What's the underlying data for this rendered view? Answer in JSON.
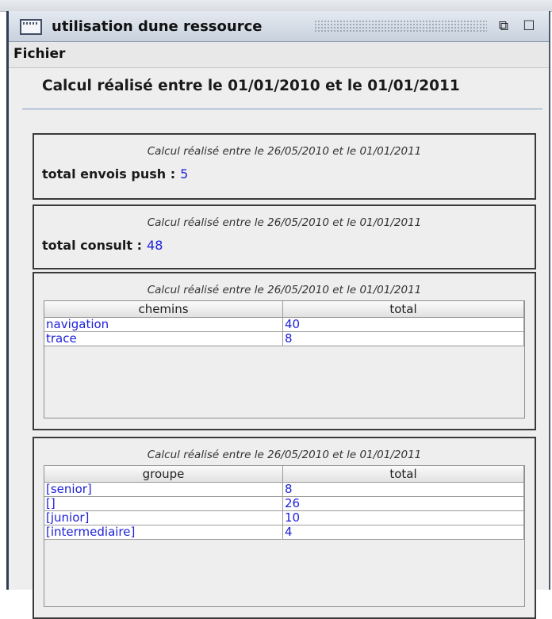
{
  "window": {
    "title": "utilisation dune ressource",
    "restore_icon": "restore-icon",
    "maximize_icon": "maximize-icon"
  },
  "menu": {
    "fichier": "Fichier"
  },
  "main": {
    "heading": "Calcul réalisé entre le 01/01/2010 et le 01/01/2011"
  },
  "panels": {
    "push": {
      "subtitle": "Calcul réalisé entre le 26/05/2010 et le 01/01/2011",
      "label": "total envois push :",
      "value": "5"
    },
    "consult": {
      "subtitle": "Calcul réalisé entre le 26/05/2010 et le 01/01/2011",
      "label": "total consult :",
      "value": "48"
    },
    "chemins": {
      "subtitle": "Calcul réalisé entre le 26/05/2010 et le 01/01/2011",
      "headers": [
        "chemins",
        "total"
      ],
      "rows": [
        [
          "navigation",
          "40"
        ],
        [
          "trace",
          "8"
        ]
      ]
    },
    "groupe": {
      "subtitle": "Calcul réalisé entre le 26/05/2010 et le 01/01/2011",
      "headers": [
        "groupe",
        "total"
      ],
      "rows": [
        [
          "[senior]",
          "8"
        ],
        [
          "[]",
          "26"
        ],
        [
          "[junior]",
          "10"
        ],
        [
          "[intermediaire]",
          "4"
        ]
      ]
    }
  },
  "colors": {
    "value_text": "#1f22d8",
    "border": "#3a3a3a"
  }
}
